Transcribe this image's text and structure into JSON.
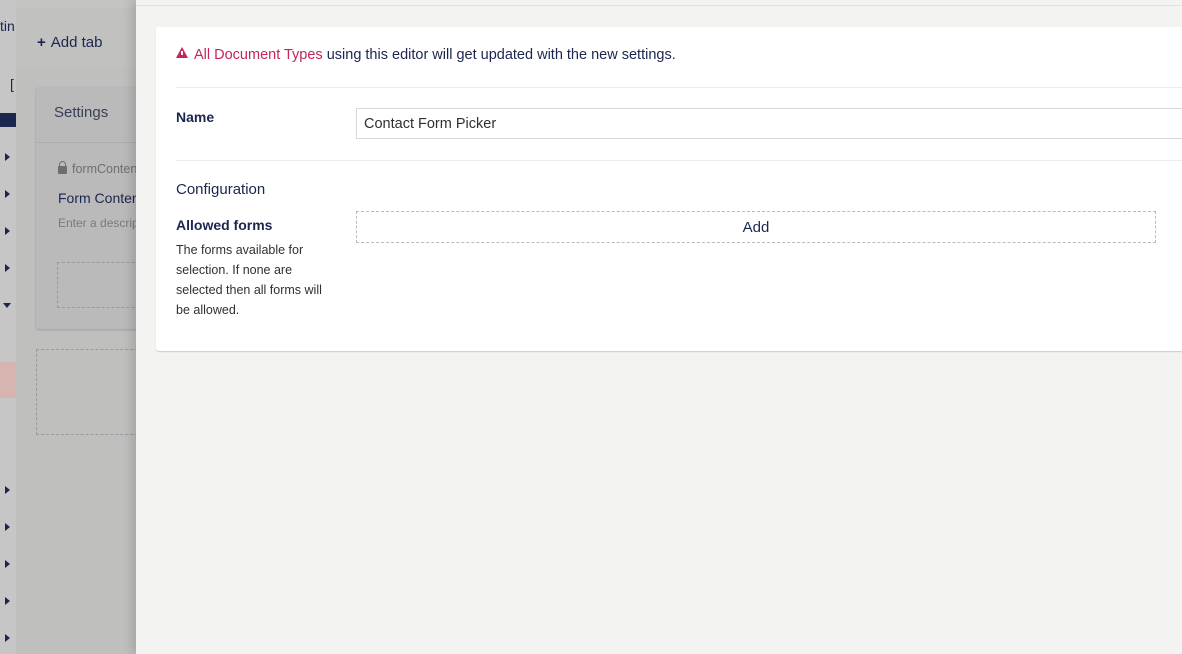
{
  "tree": {
    "cut_text_top": "tin",
    "cut_text_second": "[",
    "colors": {
      "highlight": "#d8b4b0",
      "caret": "#1b264f"
    }
  },
  "background_editor": {
    "add_tab_label": "Add tab",
    "settings_group_title": "Settings",
    "property": {
      "alias": "formContent",
      "name": "Form Content",
      "description_placeholder": "Enter a description..."
    }
  },
  "overlay": {
    "notice": {
      "link_text": "All Document Types",
      "rest_text": " using this editor will get updated with the new settings."
    },
    "name_field": {
      "label": "Name",
      "value": "Contact Form Picker"
    },
    "configuration": {
      "title": "Configuration",
      "allowed_forms": {
        "label": "Allowed forms",
        "description": "The forms available for selection. If none are selected then all forms will be allowed.",
        "add_button_label": "Add"
      }
    }
  },
  "theme": {
    "text_dark": "#1b264f",
    "accent_pink": "#c4245f",
    "card_bg": "#ffffff",
    "page_bg": "#f3f3f2"
  }
}
